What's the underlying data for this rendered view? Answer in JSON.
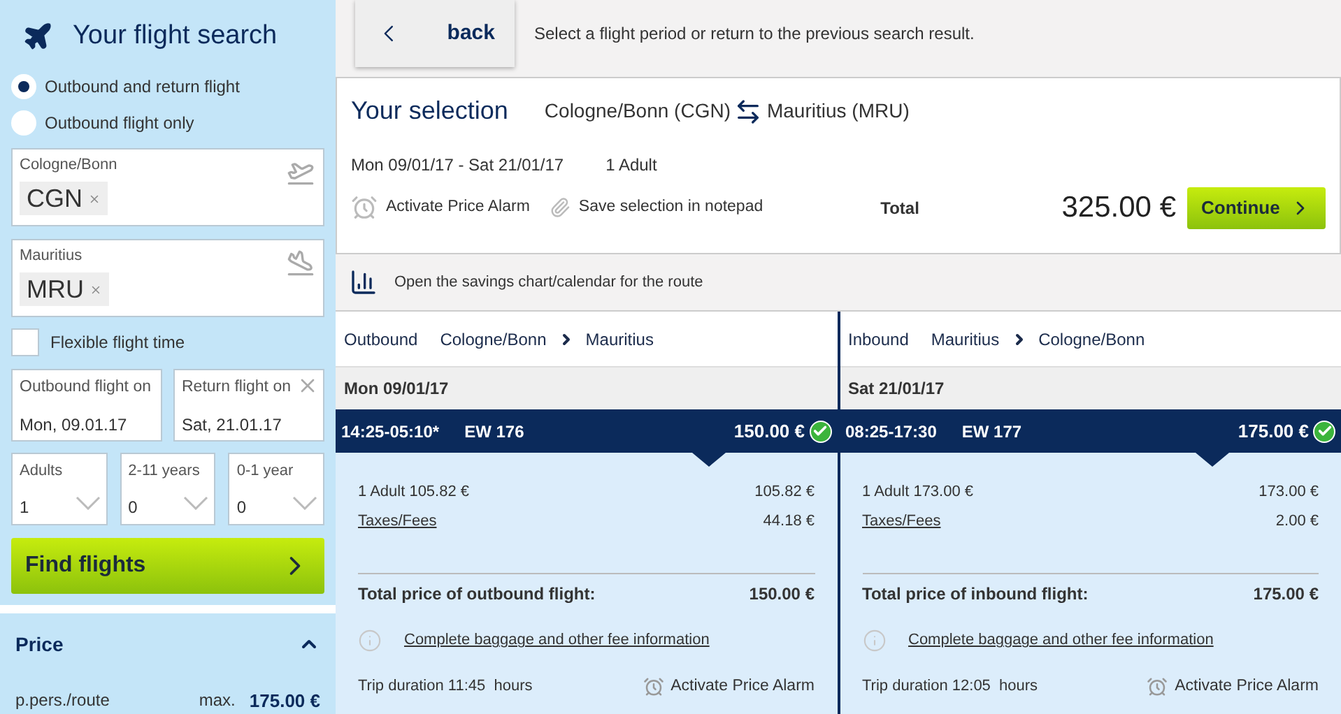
{
  "sidebar": {
    "title": "Your flight search",
    "trip_types": [
      {
        "label": "Outbound and return flight",
        "selected": true
      },
      {
        "label": "Outbound flight only",
        "selected": false
      }
    ],
    "airports": [
      {
        "label": "Cologne/Bonn",
        "code": "CGN",
        "kind": "takeoff"
      },
      {
        "label": "Mauritius",
        "code": "MRU",
        "kind": "landing"
      }
    ],
    "flexible": {
      "label": "Flexible flight time",
      "checked": false
    },
    "dates": [
      {
        "label": "Outbound flight on",
        "value": "Mon, 09.01.17",
        "clearable": false
      },
      {
        "label": "Return flight on",
        "value": "Sat, 21.01.17",
        "clearable": true
      }
    ],
    "passengers": [
      {
        "label": "Adults",
        "value": "1"
      },
      {
        "label": "2-11 years",
        "value": "0"
      },
      {
        "label": "0-1 year",
        "value": "0"
      }
    ],
    "search_button": "Find flights",
    "price_filter": {
      "title": "Price",
      "expanded": true,
      "label": "p.pers./route",
      "max_label": "max.",
      "max_value": "175.00 €"
    }
  },
  "top_bar": {
    "back_button": "back",
    "hint": "Select a flight period or return to the previous search result."
  },
  "selection": {
    "title": "Your selection",
    "from": "Cologne/Bonn (CGN)",
    "to": "Mauritius (MRU)",
    "dates": "Mon 09/01/17 - Sat 21/01/17",
    "passengers": "1 Adult",
    "actions": [
      {
        "label": "Activate Price Alarm",
        "kind": "alarm"
      },
      {
        "label": "Save selection in notepad",
        "kind": "clip"
      }
    ],
    "total_label": "Total",
    "total": "325.00 €",
    "continue_button": "Continue"
  },
  "savings_link": "Open the savings chart/calendar for the route",
  "legs": [
    {
      "direction": "Outbound",
      "from": "Cologne/Bonn",
      "to": "Mauritius",
      "date": "Mon 09/01/17",
      "flight": {
        "times": "14:25-05:10*",
        "number": "EW 176",
        "price": "150.00 €",
        "selected": true
      },
      "lines": [
        {
          "label": "1 Adult 105.82 €",
          "amount": "105.82 €",
          "kind": "text"
        },
        {
          "label": "Taxes/Fees",
          "amount": "44.18 €",
          "kind": "link"
        }
      ],
      "total_label": "Total price of outbound flight:",
      "total": "150.00 €",
      "fee_link": "Complete baggage and other fee information",
      "duration": "Trip duration 11:45  hours",
      "alarm": "Activate Price Alarm"
    },
    {
      "direction": "Inbound",
      "from": "Mauritius",
      "to": "Cologne/Bonn",
      "date": "Sat 21/01/17",
      "flight": {
        "times": "08:25-17:30",
        "number": "EW 177",
        "price": "175.00 €",
        "selected": true
      },
      "lines": [
        {
          "label": "1 Adult 173.00 €",
          "amount": "173.00 €",
          "kind": "text"
        },
        {
          "label": "Taxes/Fees",
          "amount": "2.00 €",
          "kind": "link"
        }
      ],
      "total_label": "Total price of inbound flight:",
      "total": "175.00 €",
      "fee_link": "Complete baggage and other fee information",
      "duration": "Trip duration 12:05  hours",
      "alarm": "Activate Price Alarm"
    }
  ]
}
